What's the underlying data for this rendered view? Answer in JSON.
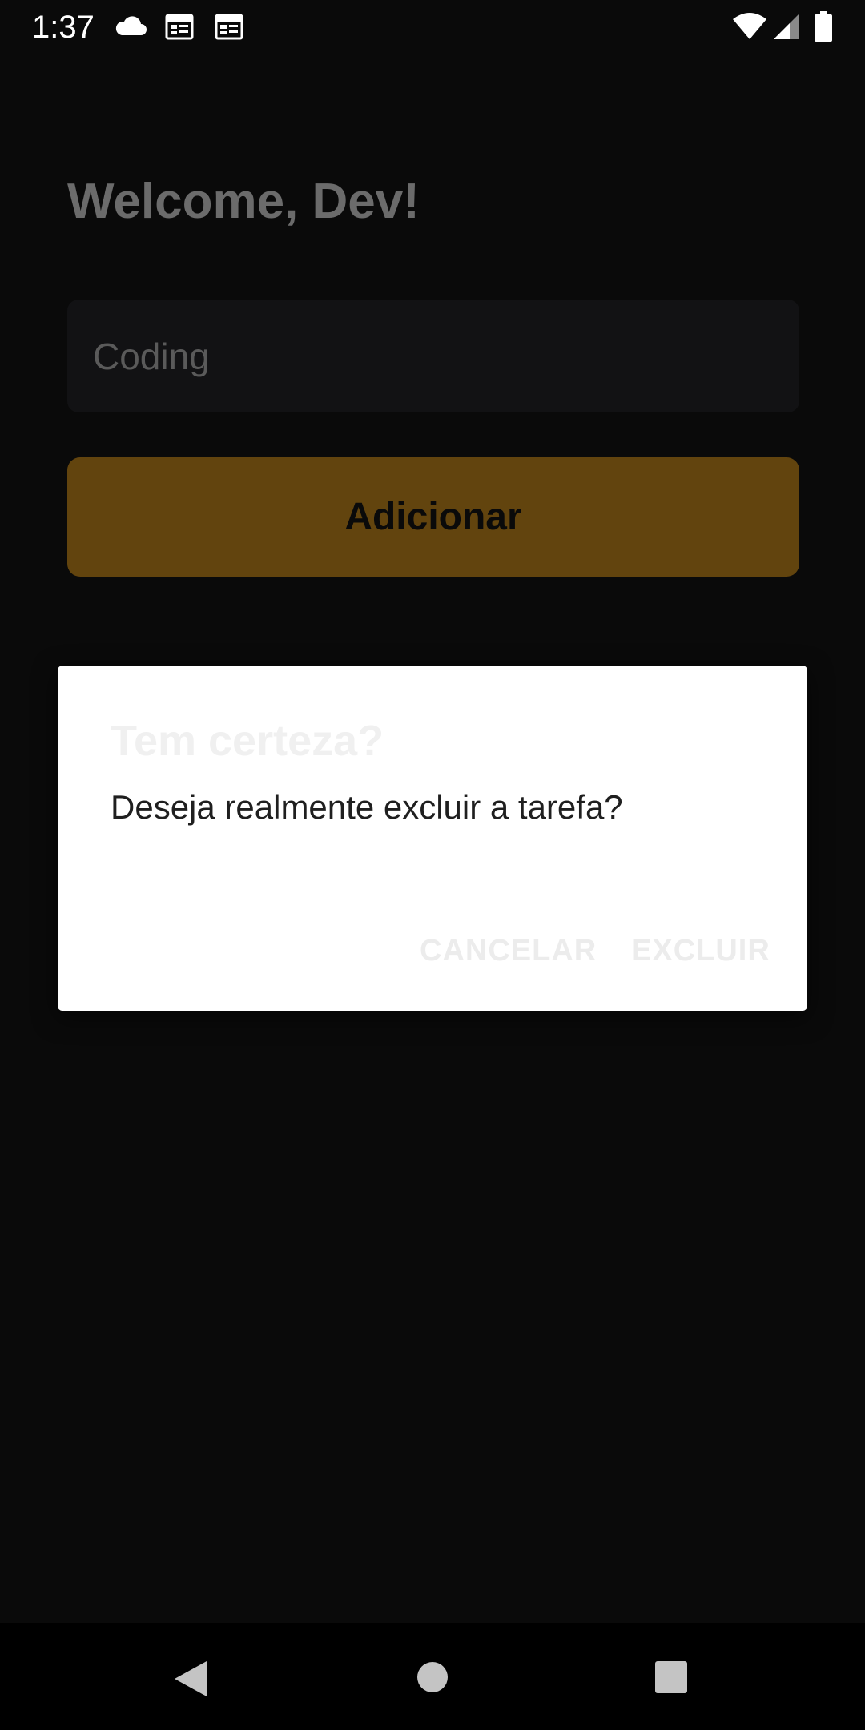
{
  "status_bar": {
    "time": "1:37",
    "icons": [
      "cloud-icon",
      "calendar-icon",
      "calendar-icon",
      "wifi-icon",
      "cellular-signal-icon",
      "battery-icon"
    ]
  },
  "main": {
    "welcome_title": "Welcome, Dev!",
    "task_input": {
      "value": "",
      "placeholder": "Coding"
    },
    "add_button_label": "Adicionar"
  },
  "dialog": {
    "title": "Tem certeza?",
    "message": "Deseja realmente excluir a tarefa?",
    "cancel_label": "CANCELAR",
    "delete_label": "EXCLUIR"
  },
  "nav_bar": {
    "icons": [
      "back-icon",
      "home-icon",
      "recents-icon"
    ]
  },
  "colors": {
    "background": "#0a0a0a",
    "input_background": "#121214",
    "accent_button": "#62440e",
    "dialog_background": "#ffffff"
  }
}
